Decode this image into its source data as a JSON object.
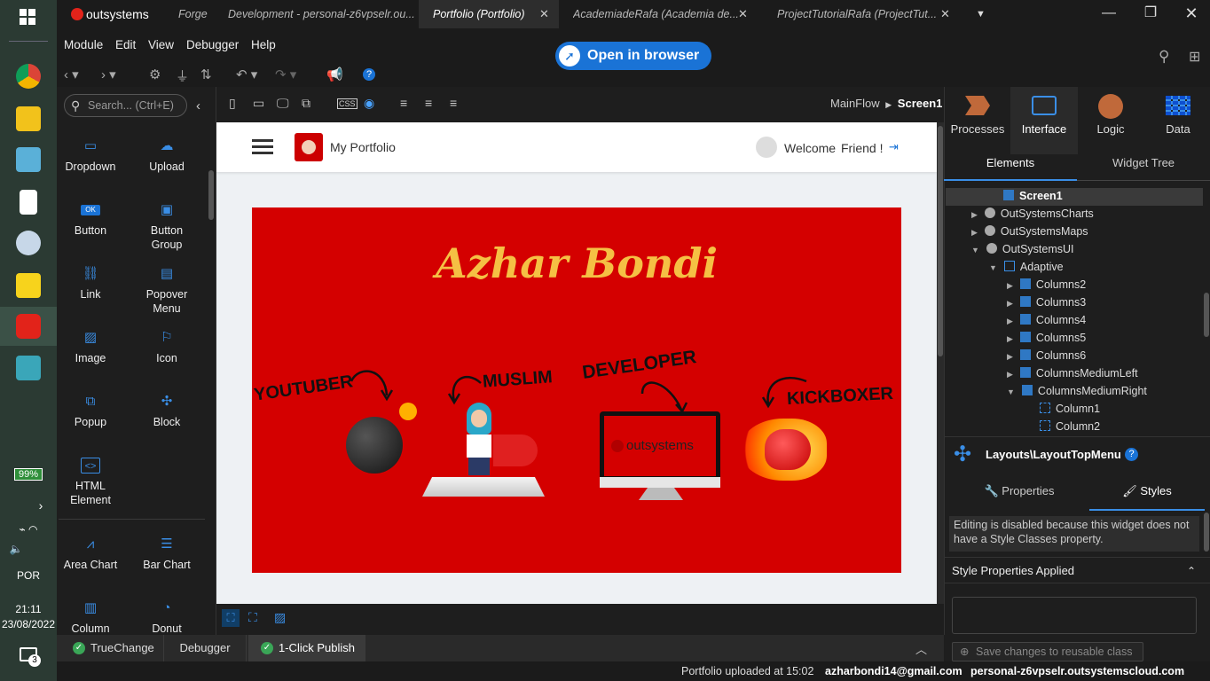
{
  "taskbar": {
    "battery": "99%",
    "language": "POR",
    "time": "21:11",
    "date": "23/08/2022",
    "notification_count": "3"
  },
  "tabs": [
    {
      "label": "outsystems"
    },
    {
      "label": "Forge"
    },
    {
      "label": "Development - personal-z6vpselr.ou..."
    },
    {
      "label": "Portfolio (Portfolio)"
    },
    {
      "label": "AcademiadeRafa (Academia de..."
    },
    {
      "label": "ProjectTutorialRafa (ProjectTut..."
    }
  ],
  "menu": [
    "Module",
    "Edit",
    "View",
    "Debugger",
    "Help"
  ],
  "open_browser": "Open in browser",
  "search_placeholder": "Search... (Ctrl+E)",
  "widgets": [
    {
      "label": "Dropdown",
      "icon": "dropdown-icon"
    },
    {
      "label": "Upload",
      "icon": "upload-icon"
    },
    {
      "label": "Button",
      "icon": "button-icon"
    },
    {
      "label": "Button Group",
      "icon": "button-group-icon"
    },
    {
      "label": "Link",
      "icon": "link-icon"
    },
    {
      "label": "Popover Menu",
      "icon": "popover-menu-icon"
    },
    {
      "label": "Image",
      "icon": "image-icon"
    },
    {
      "label": "Icon",
      "icon": "flag-icon"
    },
    {
      "label": "Popup",
      "icon": "popup-icon"
    },
    {
      "label": "Block",
      "icon": "puzzle-icon"
    },
    {
      "label": "HTML Element",
      "icon": "html-element-icon"
    },
    {
      "label": "Area Chart",
      "icon": "area-chart-icon"
    },
    {
      "label": "Bar Chart",
      "icon": "bar-chart-icon"
    },
    {
      "label": "Column",
      "icon": "column-chart-icon"
    },
    {
      "label": "Donut",
      "icon": "donut-chart-icon"
    }
  ],
  "breadcrumb": {
    "flow": "MainFlow",
    "screen": "Screen1"
  },
  "preview": {
    "app_title": "My Portfolio",
    "welcome": "Welcome",
    "user": "Friend !",
    "hero_title": "Azhar Bondi",
    "roles": [
      "YOUTUBER",
      "MUSLIM",
      "DEVELOPER",
      "KICKBOXER"
    ],
    "monitor_brand": "outsystems"
  },
  "right_tabs": [
    "Processes",
    "Interface",
    "Logic",
    "Data"
  ],
  "sub_tabs": [
    "Elements",
    "Widget Tree"
  ],
  "tree": [
    {
      "label": "Screen1"
    },
    {
      "label": "OutSystemsCharts"
    },
    {
      "label": "OutSystemsMaps"
    },
    {
      "label": "OutSystemsUI"
    },
    {
      "label": "Adaptive"
    },
    {
      "label": "Columns2"
    },
    {
      "label": "Columns3"
    },
    {
      "label": "Columns4"
    },
    {
      "label": "Columns5"
    },
    {
      "label": "Columns6"
    },
    {
      "label": "ColumnsMediumLeft"
    },
    {
      "label": "ColumnsMediumRight"
    },
    {
      "label": "Column1"
    },
    {
      "label": "Column2"
    }
  ],
  "props": {
    "widget_path": "Layouts\\LayoutTopMenu",
    "tab_properties": "Properties",
    "tab_styles": "Styles",
    "notice": "Editing is disabled because this widget does not have a Style Classes property.",
    "section": "Style Properties Applied",
    "save_btn": "Save changes to reusable class"
  },
  "bottom": {
    "truechange": "TrueChange",
    "debugger": "Debugger",
    "publish": "1-Click Publish"
  },
  "status": {
    "message": "Portfolio uploaded at 15:02",
    "email": "azharbondi14@gmail.com",
    "server": "personal-z6vpselr.outsystemscloud.com"
  },
  "colors": {
    "accent": "#1a73d6",
    "hero": "#d40000",
    "title": "#f5c044"
  }
}
